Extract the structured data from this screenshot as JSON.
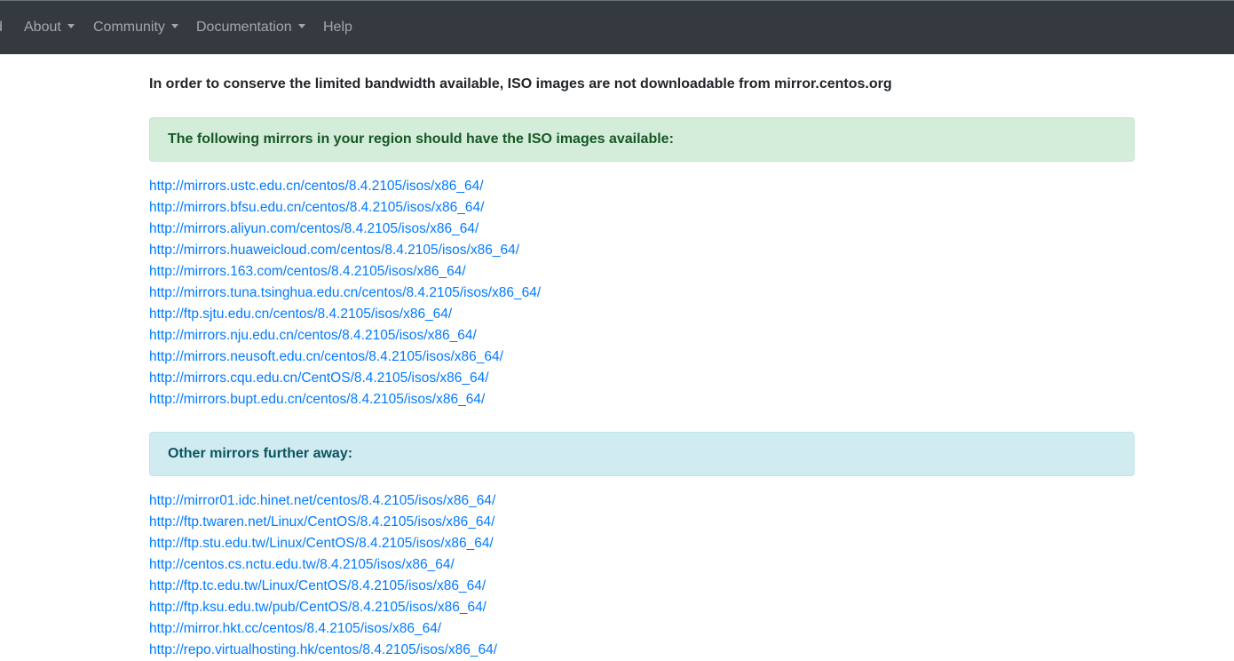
{
  "navbar": {
    "items": [
      {
        "label": "d"
      },
      {
        "label": "About"
      },
      {
        "label": "Community"
      },
      {
        "label": "Documentation"
      },
      {
        "label": "Help"
      }
    ]
  },
  "notice": "In order to conserve the limited bandwidth available, ISO images are not downloadable from mirror.centos.org",
  "region_alert": "The following mirrors in your region should have the ISO images available:",
  "region_mirrors": [
    "http://mirrors.ustc.edu.cn/centos/8.4.2105/isos/x86_64/",
    "http://mirrors.bfsu.edu.cn/centos/8.4.2105/isos/x86_64/",
    "http://mirrors.aliyun.com/centos/8.4.2105/isos/x86_64/",
    "http://mirrors.huaweicloud.com/centos/8.4.2105/isos/x86_64/",
    "http://mirrors.163.com/centos/8.4.2105/isos/x86_64/",
    "http://mirrors.tuna.tsinghua.edu.cn/centos/8.4.2105/isos/x86_64/",
    "http://ftp.sjtu.edu.cn/centos/8.4.2105/isos/x86_64/",
    "http://mirrors.nju.edu.cn/centos/8.4.2105/isos/x86_64/",
    "http://mirrors.neusoft.edu.cn/centos/8.4.2105/isos/x86_64/",
    "http://mirrors.cqu.edu.cn/CentOS/8.4.2105/isos/x86_64/",
    "http://mirrors.bupt.edu.cn/centos/8.4.2105/isos/x86_64/"
  ],
  "far_alert": "Other mirrors further away:",
  "far_mirrors": [
    "http://mirror01.idc.hinet.net/centos/8.4.2105/isos/x86_64/",
    "http://ftp.twaren.net/Linux/CentOS/8.4.2105/isos/x86_64/",
    "http://ftp.stu.edu.tw/Linux/CentOS/8.4.2105/isos/x86_64/",
    "http://centos.cs.nctu.edu.tw/8.4.2105/isos/x86_64/",
    "http://ftp.tc.edu.tw/Linux/CentOS/8.4.2105/isos/x86_64/",
    "http://ftp.ksu.edu.tw/pub/CentOS/8.4.2105/isos/x86_64/",
    "http://mirror.hkt.cc/centos/8.4.2105/isos/x86_64/",
    "http://repo.virtualhosting.hk/centos/8.4.2105/isos/x86_64/"
  ],
  "colors": {
    "navbar_bg": "#343a40",
    "link": "#007bff",
    "success_bg": "#d4edda",
    "info_bg": "#d1ecf1"
  }
}
